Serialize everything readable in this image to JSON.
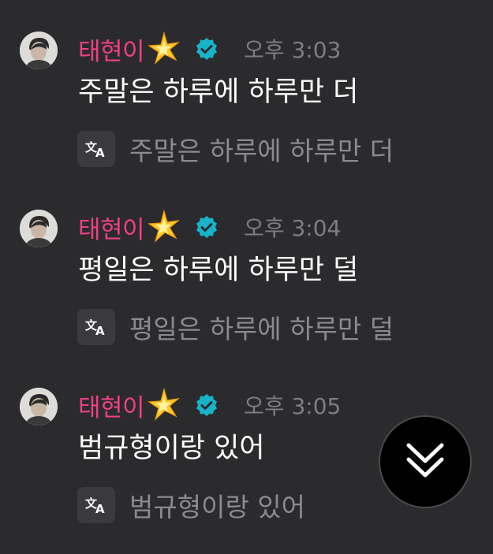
{
  "messages": [
    {
      "nickname": "태현이",
      "time": "오후 3:03",
      "text": "주말은 하루에 하루만 더",
      "translation": "주말은 하루에 하루만 더"
    },
    {
      "nickname": "태현이",
      "time": "오후 3:04",
      "text": "평일은 하루에 하루만 덜",
      "translation": "평일은 하루에 하루만 덜"
    },
    {
      "nickname": "태현이",
      "time": "오후 3:05",
      "text": "범규형이랑 있어",
      "translation": "범규형이랑 있어"
    }
  ],
  "icons": {
    "sparkle": "sparkle-star-icon",
    "verified": "verified-badge-icon",
    "translate": "translate-icon",
    "scroll": "double-chevron-down-icon"
  },
  "colors": {
    "background": "#2b2b2d",
    "nickname": "#ee3f86",
    "verified": "#18b3c8",
    "timestamp": "#7e7e82",
    "message": "#ffffff",
    "translation": "#8b8b8e"
  }
}
